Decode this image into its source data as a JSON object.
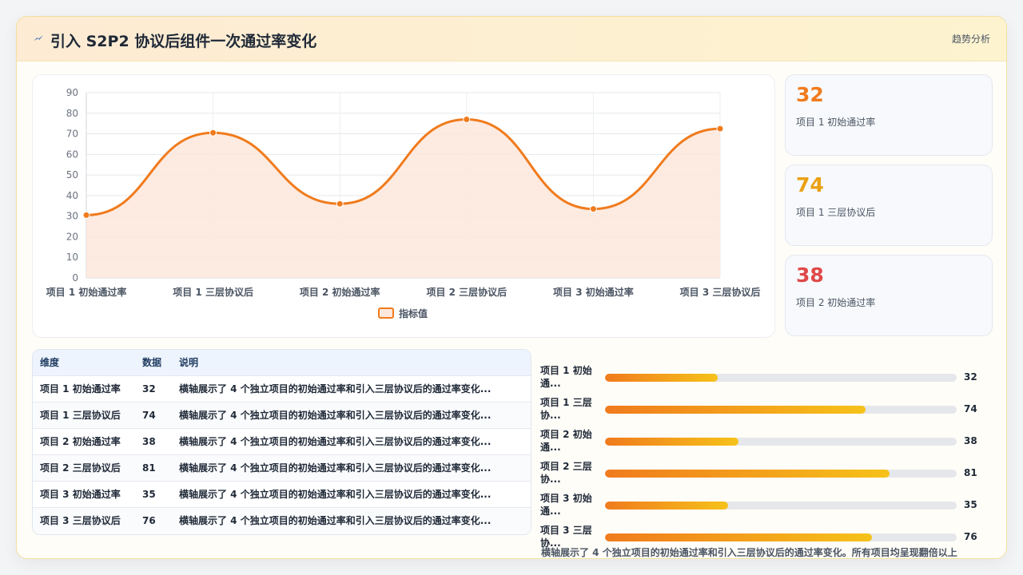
{
  "header": {
    "title": "引入 S2P2 协议后组件一次通过率变化",
    "action": "趋势分析",
    "icon": "lightning-icon"
  },
  "chart_data": {
    "type": "line",
    "categories": [
      "项目 1 初始通过率",
      "项目 1 三层协议后",
      "项目 2 初始通过率",
      "项目 2 三层协议后",
      "项目 3 初始通过率",
      "项目 3 三层协议后"
    ],
    "series": [
      {
        "name": "指标值",
        "values": [
          30.5,
          70.5,
          36,
          77,
          33.5,
          72.5
        ]
      }
    ],
    "ylim": [
      0,
      90
    ],
    "yticks": [
      0,
      10,
      20,
      30,
      40,
      50,
      60,
      70,
      80,
      90
    ],
    "grid": true,
    "legend": "bottom",
    "colors": {
      "line": "#f07b1d",
      "fill": "#fde8dc"
    }
  },
  "kpis": [
    {
      "value": "32",
      "label": "项目 1 初始通过率",
      "color": "#f07b1d"
    },
    {
      "value": "74",
      "label": "项目 1 三层协议后",
      "color": "#eaa114"
    },
    {
      "value": "38",
      "label": "项目 2 初始通过率",
      "color": "#e04848"
    }
  ],
  "table": {
    "headers": [
      "维度",
      "数据",
      "说明"
    ],
    "rows": [
      {
        "dim": "项目 1 初始通过率",
        "value": "32",
        "desc": "横轴展示了 4 个独立项目的初始通过率和引入三层协议后的通过率变化..."
      },
      {
        "dim": "项目 1 三层协议后",
        "value": "74",
        "desc": "横轴展示了 4 个独立项目的初始通过率和引入三层协议后的通过率变化..."
      },
      {
        "dim": "项目 2 初始通过率",
        "value": "38",
        "desc": "横轴展示了 4 个独立项目的初始通过率和引入三层协议后的通过率变化..."
      },
      {
        "dim": "项目 2 三层协议后",
        "value": "81",
        "desc": "横轴展示了 4 个独立项目的初始通过率和引入三层协议后的通过率变化..."
      },
      {
        "dim": "项目 3 初始通过率",
        "value": "35",
        "desc": "横轴展示了 4 个独立项目的初始通过率和引入三层协议后的通过率变化..."
      },
      {
        "dim": "项目 3 三层协议后",
        "value": "76",
        "desc": "横轴展示了 4 个独立项目的初始通过率和引入三层协议后的通过率变化..."
      }
    ]
  },
  "bars": {
    "max": 100,
    "items": [
      {
        "label": "项目 1 初始通...",
        "value": 32
      },
      {
        "label": "项目 1 三层协...",
        "value": 74
      },
      {
        "label": "项目 2 初始通...",
        "value": 38
      },
      {
        "label": "项目 2 三层协...",
        "value": 81
      },
      {
        "label": "项目 3 初始通...",
        "value": 35
      },
      {
        "label": "项目 3 三层协...",
        "value": 76
      }
    ]
  },
  "footnote": "横轴展示了 4 个独立项目的初始通过率和引入三层协议后的通过率变化。所有项目均呈现翻倍以上"
}
